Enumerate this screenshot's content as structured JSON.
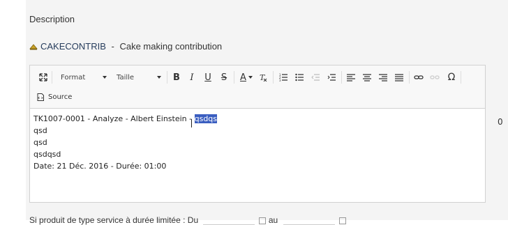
{
  "section": {
    "title": "Description"
  },
  "product": {
    "ref": "CAKECONTRIB",
    "separator": " - ",
    "label": "Cake making contribution"
  },
  "toolbar": {
    "format_label": "Format",
    "size_label": "Taille",
    "source_label": "Source",
    "bold": "B",
    "italic": "I",
    "underline": "U",
    "strike": "S",
    "text_color": "A",
    "omega": "Ω"
  },
  "editor": {
    "line1_prefix": "TK1007-0001 - Analyze - Albert Einstein - ",
    "line1_selected": "qsdqs",
    "line2": "qsd",
    "line3": "qsd",
    "line4": "qsdqsd",
    "line5": "Date: 21 Déc. 2016 - Durée: 01:00"
  },
  "side_value": "0",
  "bottom": {
    "label": "Si produit de type service à durée limitée : Du",
    "to_label": "au"
  }
}
